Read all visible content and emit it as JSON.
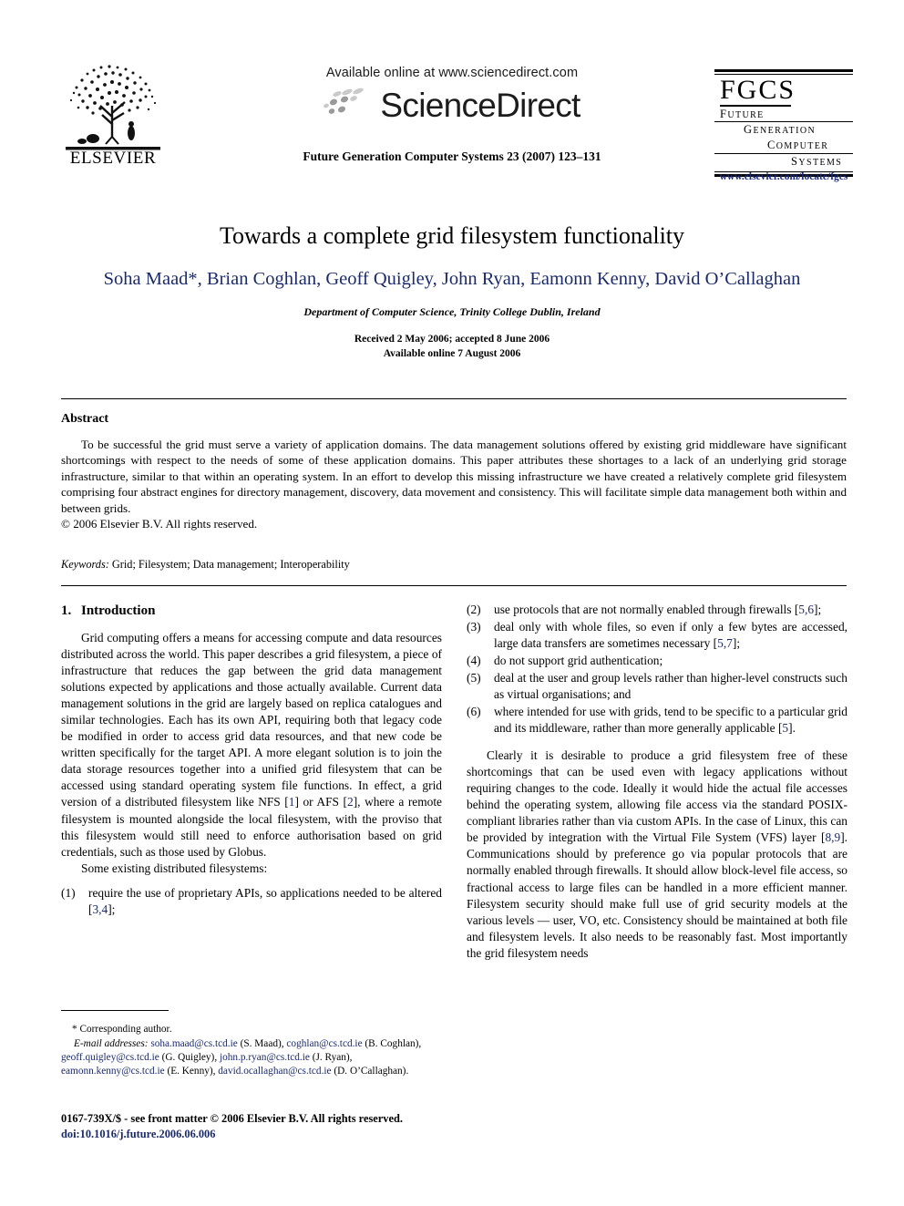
{
  "masthead": {
    "publisher_name": "ELSEVIER",
    "publisher_logo_icon": "elsevier-tree-icon",
    "available_online": "Available online at www.sciencedirect.com",
    "sciencedirect_wordmark": "ScienceDirect",
    "sciencedirect_logo_icon": "sciencedirect-dots-icon",
    "journal_reference": "Future Generation Computer Systems 23 (2007) 123–131",
    "fgcs": {
      "acronym": "FGCS",
      "line1_cap": "F",
      "line1_rest": "UTURE",
      "line2_cap": "G",
      "line2_rest": "ENERATION",
      "line3_cap": "C",
      "line3_rest": "OMPUTER",
      "line4_cap": "S",
      "line4_rest": "YSTEMS"
    },
    "journal_url": "www.elsevier.com/locate/fgcs"
  },
  "title_block": {
    "title": "Towards a complete grid filesystem functionality",
    "authors": "Soha Maad*, Brian Coghlan, Geoff Quigley, John Ryan, Eamonn Kenny, David O’Callaghan",
    "affiliation": "Department of Computer Science, Trinity College Dublin, Ireland",
    "received_line": "Received 2 May 2006; accepted 8 June 2006",
    "available_line": "Available online 7 August 2006",
    "authors_color": "#1b2a6b"
  },
  "abstract": {
    "heading": "Abstract",
    "body": "To be successful the grid must serve a variety of application domains. The data management solutions offered by existing grid middleware have significant shortcomings with respect to the needs of some of these application domains. This paper attributes these shortages to a lack of an underlying grid storage infrastructure, similar to that within an operating system. In an effort to develop this missing infrastructure we have created a relatively complete grid filesystem comprising four abstract engines for directory management, discovery, data movement and consistency. This will facilitate simple data management both within and between grids.",
    "copyright": "© 2006 Elsevier B.V. All rights reserved.",
    "keywords_label": "Keywords:",
    "keywords_value": "Grid; Filesystem; Data management; Interoperability"
  },
  "left_column": {
    "section_number": "1.",
    "section_title": "Introduction",
    "paragraph1_a": "Grid computing offers a means for accessing compute and data resources distributed across the world. This paper describes a grid filesystem, a piece of infrastructure that reduces the gap between the grid data management solutions expected by applications and those actually available. Current data management solutions in the grid are largely based on replica catalogues and similar technologies. Each has its own API, requiring both that legacy code be modified in order to access grid data resources, and that new code be written specifically for the target API. A more elegant solution is to join the data storage resources together into a unified grid filesystem that can be accessed using standard operating system file functions. In effect, a grid version of a distributed filesystem like NFS [",
    "paragraph1_cite1": "1",
    "paragraph1_b": "] or AFS [",
    "paragraph1_cite2": "2",
    "paragraph1_c": "], where a remote filesystem is mounted alongside the local filesystem, with the proviso that this filesystem would still need to enforce authorisation based on grid credentials, such as those used by Globus.",
    "lead_in": "Some existing distributed filesystems:",
    "list_item1_marker": "(1)",
    "list_item1_text_a": "require the use of proprietary APIs, so applications needed to be altered [",
    "list_item1_cite": "3,4",
    "list_item1_text_b": "];"
  },
  "right_column": {
    "list_item2_marker": "(2)",
    "list_item2_text_a": "use protocols that are not normally enabled through firewalls [",
    "list_item2_cite": "5,6",
    "list_item2_text_b": "];",
    "list_item3_marker": "(3)",
    "list_item3_text_a": "deal only with whole files, so even if only a few bytes are accessed, large data transfers are sometimes necessary [",
    "list_item3_cite": "5,7",
    "list_item3_text_b": "];",
    "list_item4_marker": "(4)",
    "list_item4_text": "do not support grid authentication;",
    "list_item5_marker": "(5)",
    "list_item5_text": "deal at the user and group levels rather than higher-level constructs such as virtual organisations; and",
    "list_item6_marker": "(6)",
    "list_item6_text_a": "where intended for use with grids, tend to be specific to a particular grid and its middleware, rather than more generally applicable [",
    "list_item6_cite": "5",
    "list_item6_text_b": "].",
    "paragraph2_a": "Clearly it is desirable to produce a grid filesystem free of these shortcomings that can be used even with legacy applications without requiring changes to the code. Ideally it would hide the actual file accesses behind the operating system, allowing file access via the standard POSIX-compliant libraries rather than via custom APIs. In the case of Linux, this can be provided by integration with the Virtual File System (VFS) layer [",
    "paragraph2_cite": "8,9",
    "paragraph2_b": "]. Communications should by preference go via popular protocols that are normally enabled through firewalls. It should allow block-level file access, so fractional access to large files can be handled in a more efficient manner. Filesystem security should make full use of grid security models at the various levels — user, VO, etc. Consistency should be maintained at both file and filesystem levels. It also needs to be reasonably fast. Most importantly the grid filesystem needs"
  },
  "footnote": {
    "corresponding_marker": "*",
    "corresponding_text": "Corresponding author.",
    "emails_label": "E-mail addresses:",
    "email1": "soha.maad@cs.tcd.ie",
    "email1_owner": "(S. Maad),",
    "email2": "coghlan@cs.tcd.ie",
    "email2_owner": "(B. Coghlan),",
    "email3": "geoff.quigley@cs.tcd.ie",
    "email3_owner": "(G. Quigley),",
    "email4": "john.p.ryan@cs.tcd.ie",
    "email4_owner": "(J. Ryan),",
    "email5": "eamonn.kenny@cs.tcd.ie",
    "email5_owner": "(E. Kenny),",
    "email6": "david.ocallaghan@cs.tcd.ie",
    "email6_owner": "(D. O’Callaghan)."
  },
  "page_footer": {
    "front_matter": "0167-739X/$ - see front matter © 2006 Elsevier B.V. All rights reserved.",
    "doi": "doi:10.1016/j.future.2006.06.006"
  }
}
